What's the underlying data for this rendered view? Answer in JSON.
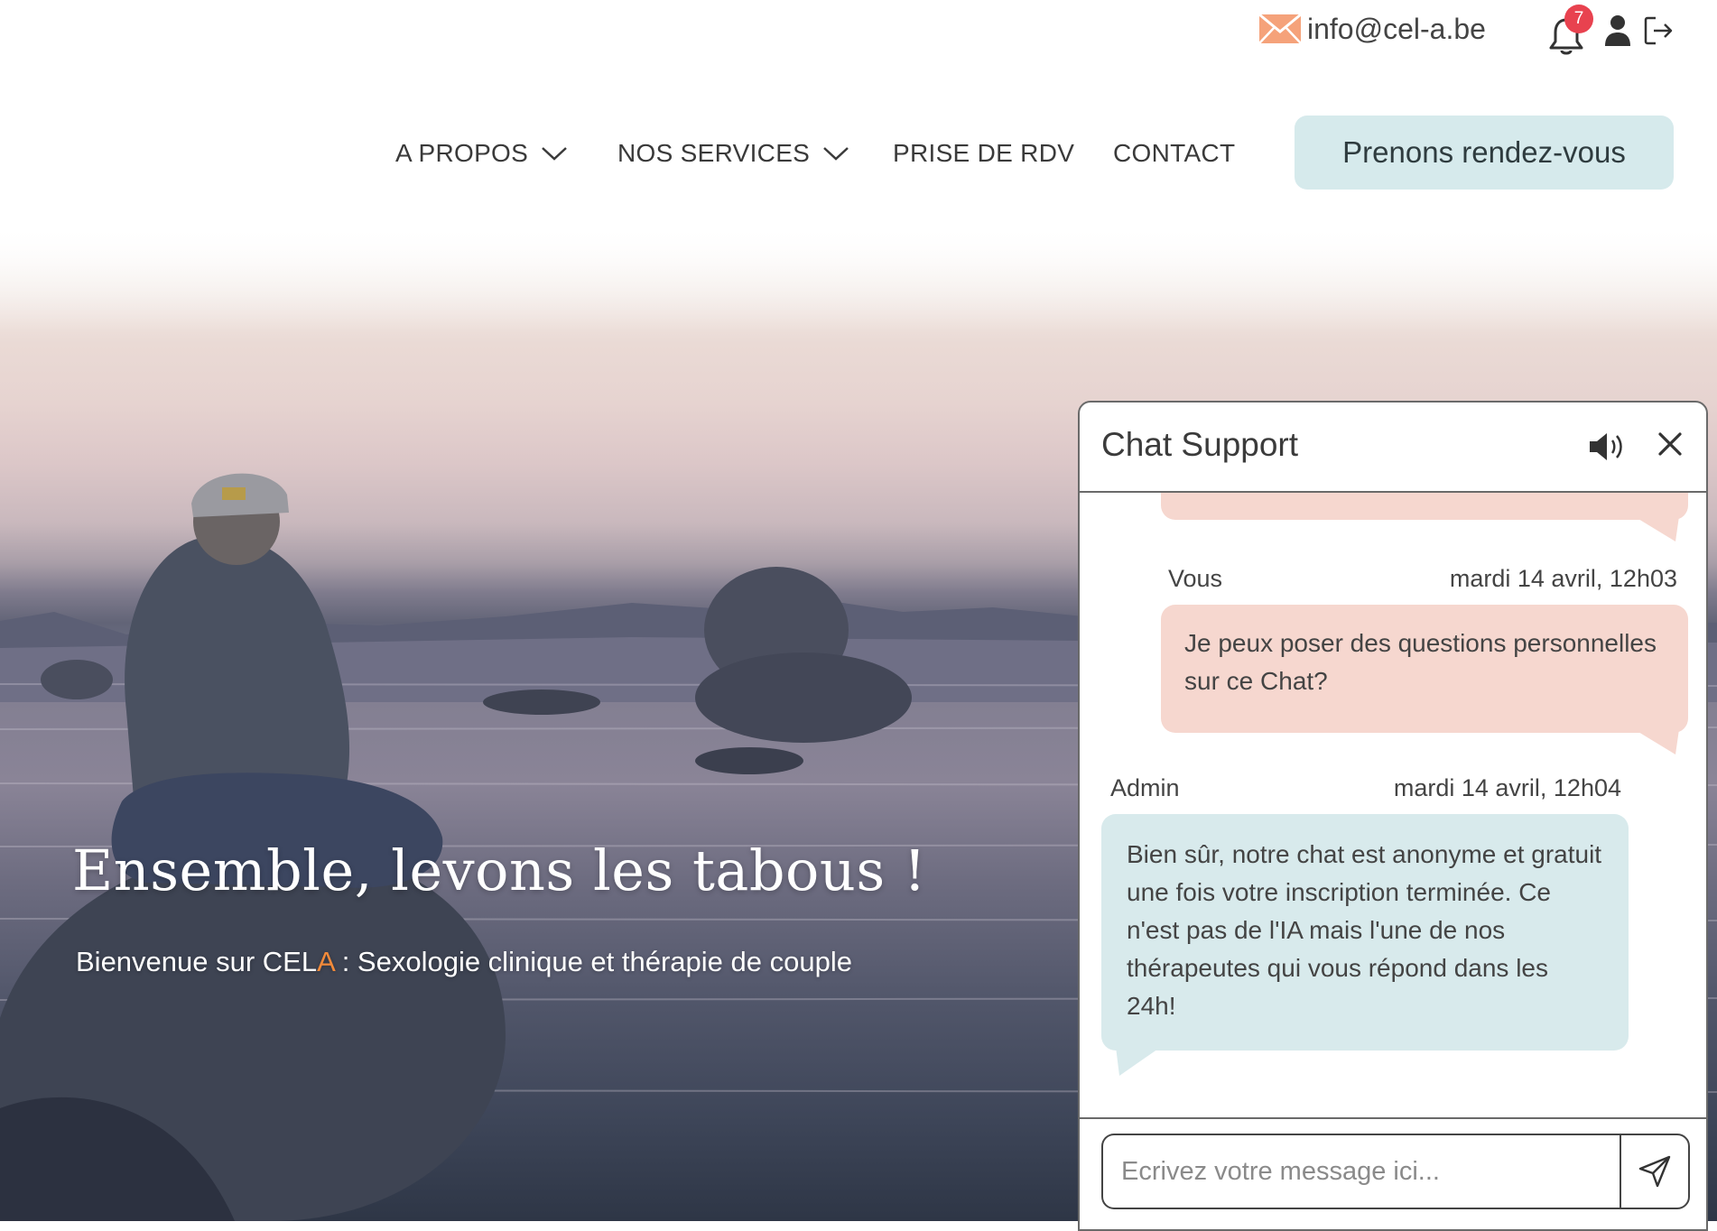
{
  "topbar": {
    "email": "info@cel-a.be",
    "notification_count": "7",
    "icons": [
      "mail-icon",
      "bell-icon",
      "user-icon",
      "logout-icon"
    ]
  },
  "nav": {
    "items": [
      {
        "label": "A PROPOS",
        "has_dropdown": true
      },
      {
        "label": "NOS SERVICES",
        "has_dropdown": true
      },
      {
        "label": "PRISE DE RDV",
        "has_dropdown": false
      },
      {
        "label": "CONTACT",
        "has_dropdown": false
      }
    ],
    "cta_label": "Prenons rendez-vous"
  },
  "hero": {
    "title": "Ensemble, levons les tabous !",
    "subtitle_before": "Bienvenue sur CEL",
    "subtitle_accent": "A",
    "subtitle_after": " : Sexologie clinique et thérapie de couple"
  },
  "chat": {
    "title": "Chat Support",
    "messages": [
      {
        "author": "Vous",
        "timestamp": "mardi 14 avril, 12h03",
        "text": "Je peux poser des questions personnelles sur ce Chat?"
      },
      {
        "author": "Admin",
        "timestamp": "mardi 14 avril, 12h04",
        "text": "Bien sûr, notre chat est anonyme et gratuit une fois votre inscription terminée. Ce n'est pas de l'IA mais l'une de nos thérapeutes qui vous répond dans les 24h!"
      }
    ],
    "input_placeholder": "Ecrivez votre message ici..."
  },
  "colors": {
    "cta_bg": "#d6eaec",
    "badge": "#e8424f",
    "user_bubble": "#f6d7cf",
    "admin_bubble": "#d8eaec",
    "accent": "#f28a3a"
  }
}
